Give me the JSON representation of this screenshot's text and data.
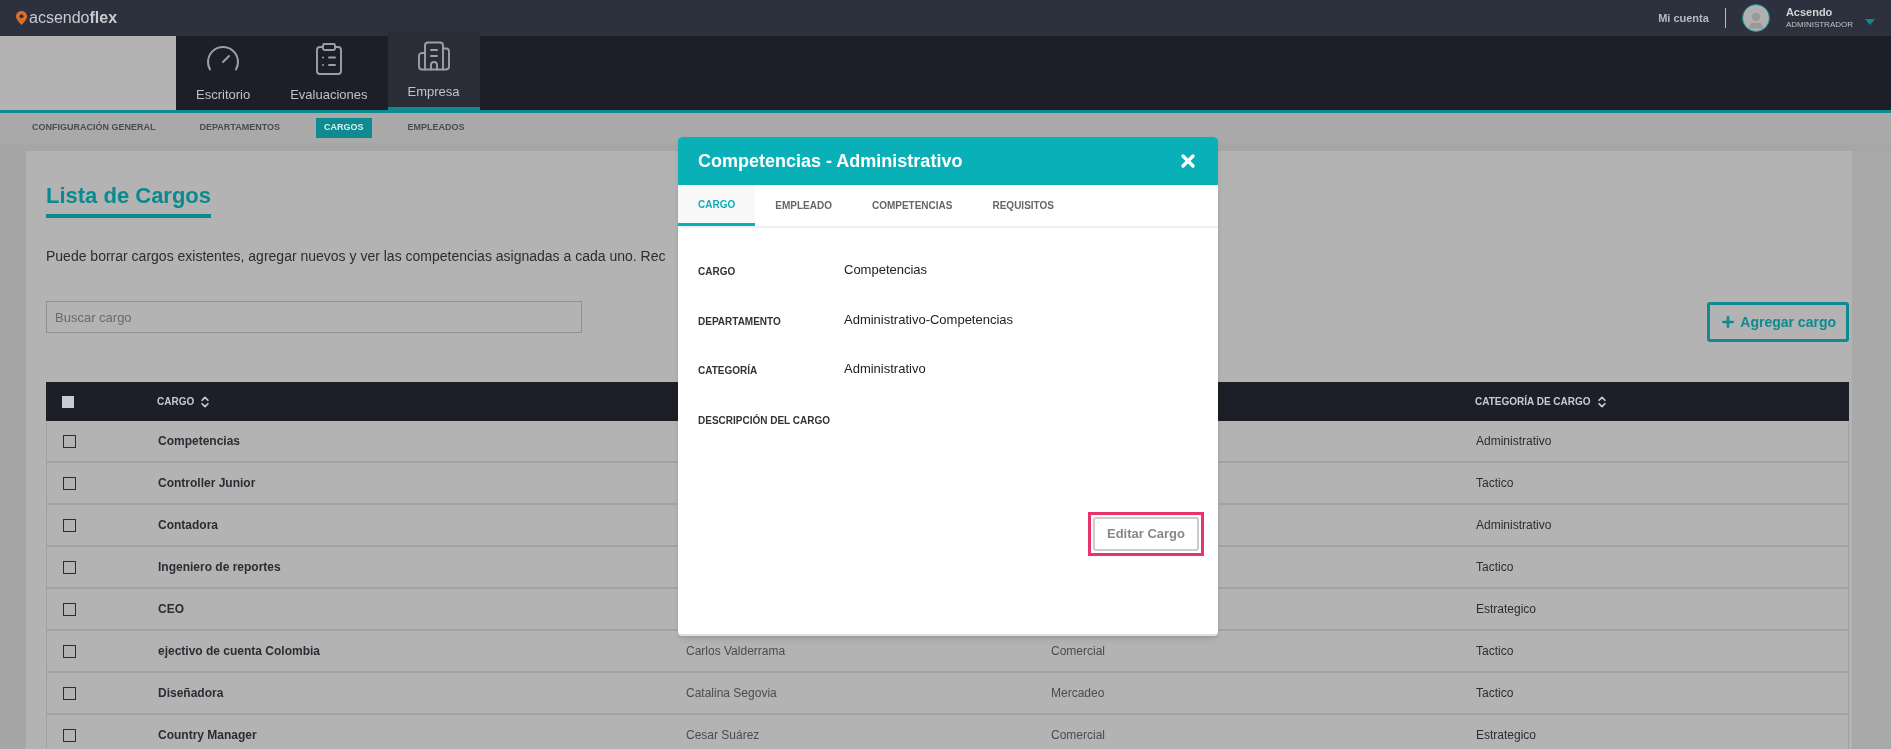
{
  "top_bar": {
    "logo": "acsendo**flex**",
    "account_link": "Mi cuenta",
    "user_name": "Acsendo",
    "user_role": "ADMINISTRADOR"
  },
  "main_nav": [
    {
      "label": "Escritorio",
      "kind": "gauge",
      "selected": false
    },
    {
      "label": "Evaluaciones",
      "kind": "clipboard",
      "selected": false
    },
    {
      "label": "Empresa",
      "kind": "building",
      "selected": true
    }
  ],
  "sub_nav": [
    {
      "label": "CONFIGURACIÓN GENERAL",
      "selected": false
    },
    {
      "label": "DEPARTAMENTOS",
      "selected": false
    },
    {
      "label": "CARGOS",
      "selected": true
    },
    {
      "label": "EMPLEADOS",
      "selected": false
    }
  ],
  "page": {
    "title": "Lista de Cargos",
    "description": "Puede borrar cargos existentes, agregar nuevos y ver las competencias asignadas a cada uno. Rec",
    "search": {
      "placeholder": "Buscar cargo"
    },
    "add_button": "Agregar cargo"
  },
  "table": {
    "select_all": {
      "checked": false
    },
    "columns": [
      "CARGO",
      "CATEGORÍA DE CARGO"
    ],
    "rows": [
      {
        "checked": false,
        "cargo": "Competencias",
        "categoria": "Administrativo"
      },
      {
        "checked": false,
        "cargo": "Controller Junior",
        "categoria": "Tactico"
      },
      {
        "checked": false,
        "cargo": "Contadora",
        "categoria": "Administrativo"
      },
      {
        "checked": false,
        "cargo": "Ingeniero de reportes",
        "categoria": "Tactico"
      },
      {
        "checked": false,
        "cargo": "CEO",
        "categoria": "Estrategico"
      },
      {
        "checked": false,
        "cargo": "ejectivo de cuenta Colombia",
        "column_2": "Carlos Valderrama",
        "column_3": "Comercial",
        "categoria": "Tactico"
      },
      {
        "checked": false,
        "cargo": "Diseñadora",
        "column_2": "Catalina Segovia",
        "column_3": "Mercadeo",
        "categoria": "Tactico"
      },
      {
        "checked": false,
        "cargo": "Country Manager",
        "column_2": "Cesar Suárez",
        "column_3": "Comercial",
        "categoria": "Estrategico"
      }
    ]
  },
  "modal": {
    "title": "Competencias - Administrativo",
    "tabs": [
      {
        "label": "CARGO",
        "selected": true
      },
      {
        "label": "EMPLEADO",
        "selected": false
      },
      {
        "label": "COMPETENCIAS",
        "selected": false
      },
      {
        "label": "REQUISITOS",
        "selected": false
      }
    ],
    "fields": [
      {
        "label": "CARGO",
        "value": "Competencias"
      },
      {
        "label": "DEPARTAMENTO",
        "value": "Administrativo-Competencias"
      },
      {
        "label": "CATEGORÍA",
        "value": "Administrativo"
      },
      {
        "label": "DESCRIPCIÓN DEL CARGO"
      }
    ],
    "edit_button": "Editar Cargo"
  }
}
